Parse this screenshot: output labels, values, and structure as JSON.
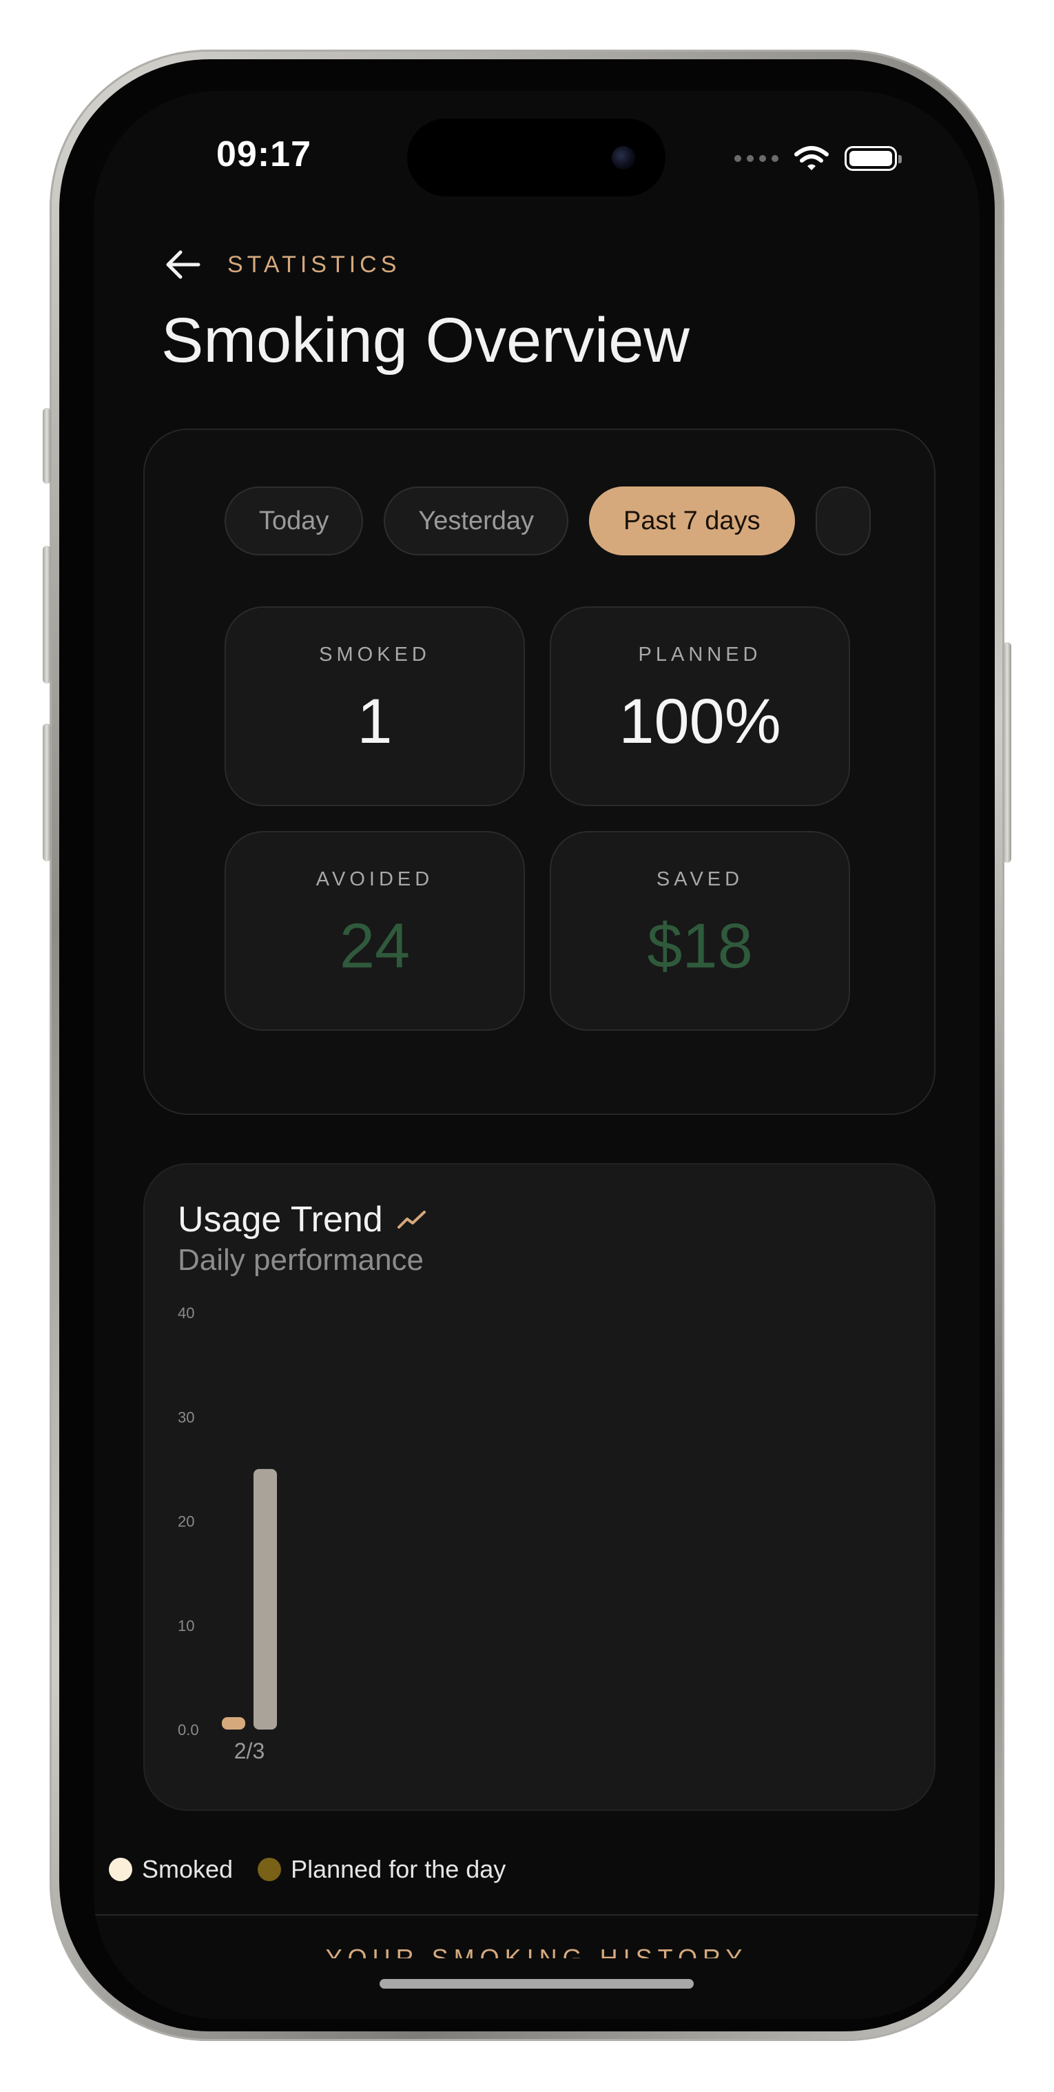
{
  "status_bar": {
    "time": "09:17"
  },
  "header": {
    "eyebrow": "STATISTICS",
    "title": "Smoking Overview"
  },
  "filters": {
    "chips": [
      "Today",
      "Yesterday",
      "Past 7 days"
    ],
    "active": "Past 7 days"
  },
  "stats": {
    "smoked": {
      "label": "SMOKED",
      "value": "1"
    },
    "planned": {
      "label": "PLANNED",
      "value": "100%"
    },
    "avoided": {
      "label": "AVOIDED",
      "value": "24"
    },
    "saved": {
      "label": "SAVED",
      "value": "$18"
    }
  },
  "trend": {
    "title": "Usage Trend",
    "subtitle": "Daily performance"
  },
  "chart_data": {
    "type": "bar",
    "categories": [
      "2/3"
    ],
    "series": [
      {
        "name": "Smoked",
        "values": [
          1
        ]
      },
      {
        "name": "Planned for the day",
        "values": [
          25
        ]
      }
    ],
    "y_ticks": [
      "0.0",
      "10",
      "20",
      "30",
      "40"
    ],
    "ylim": [
      0,
      40
    ],
    "colors": {
      "smoked": "#d6a97d",
      "planned": "#aaa39a"
    }
  },
  "legend": {
    "smoked": "Smoked",
    "planned": "Planned for the day",
    "smoked_color": "#fcefd9",
    "planned_color": "#7a6118"
  },
  "history": {
    "label": "YOUR SMOKING HISTORY"
  },
  "colors": {
    "accent": "#d6a97d",
    "positive": "#2f5a3c",
    "background": "#0b0b0b"
  }
}
